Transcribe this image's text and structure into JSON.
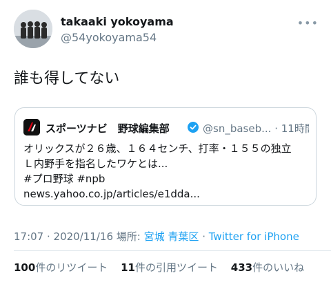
{
  "author": {
    "name": "takaaki yokoyama",
    "handle": "@54yokoyama54"
  },
  "more_icon": "•••",
  "tweet_text": "誰も得してない",
  "quote": {
    "logo_icon": "sportsnavi-logo",
    "name": "スポーツナビ　野球編集部",
    "verified_icon": "verified-badge",
    "handle": "@sn_baseb...",
    "separator": "·",
    "time": "11時間",
    "lines": [
      "オリックスが２６歳、１６４センチ、打率・１５５の独立",
      "Ｌ内野手を指名したワケとは...",
      "#プロ野球 #npb",
      "news.yahoo.co.jp/articles/e1dda..."
    ]
  },
  "meta": {
    "timestamp": "17:07 · 2020/11/16",
    "location_label": "場所:",
    "location": "宮城 青葉区",
    "separator": "·",
    "source": "Twitter for iPhone"
  },
  "stats": {
    "retweets_count": "100",
    "retweets_label": "件のリツイート",
    "quotes_count": "11",
    "quotes_label": "件の引用ツイート",
    "likes_count": "433",
    "likes_label": "件のいいね"
  },
  "colors": {
    "link": "#1da1f2",
    "secondary_text": "#657786",
    "border": "#ccd6dd"
  }
}
